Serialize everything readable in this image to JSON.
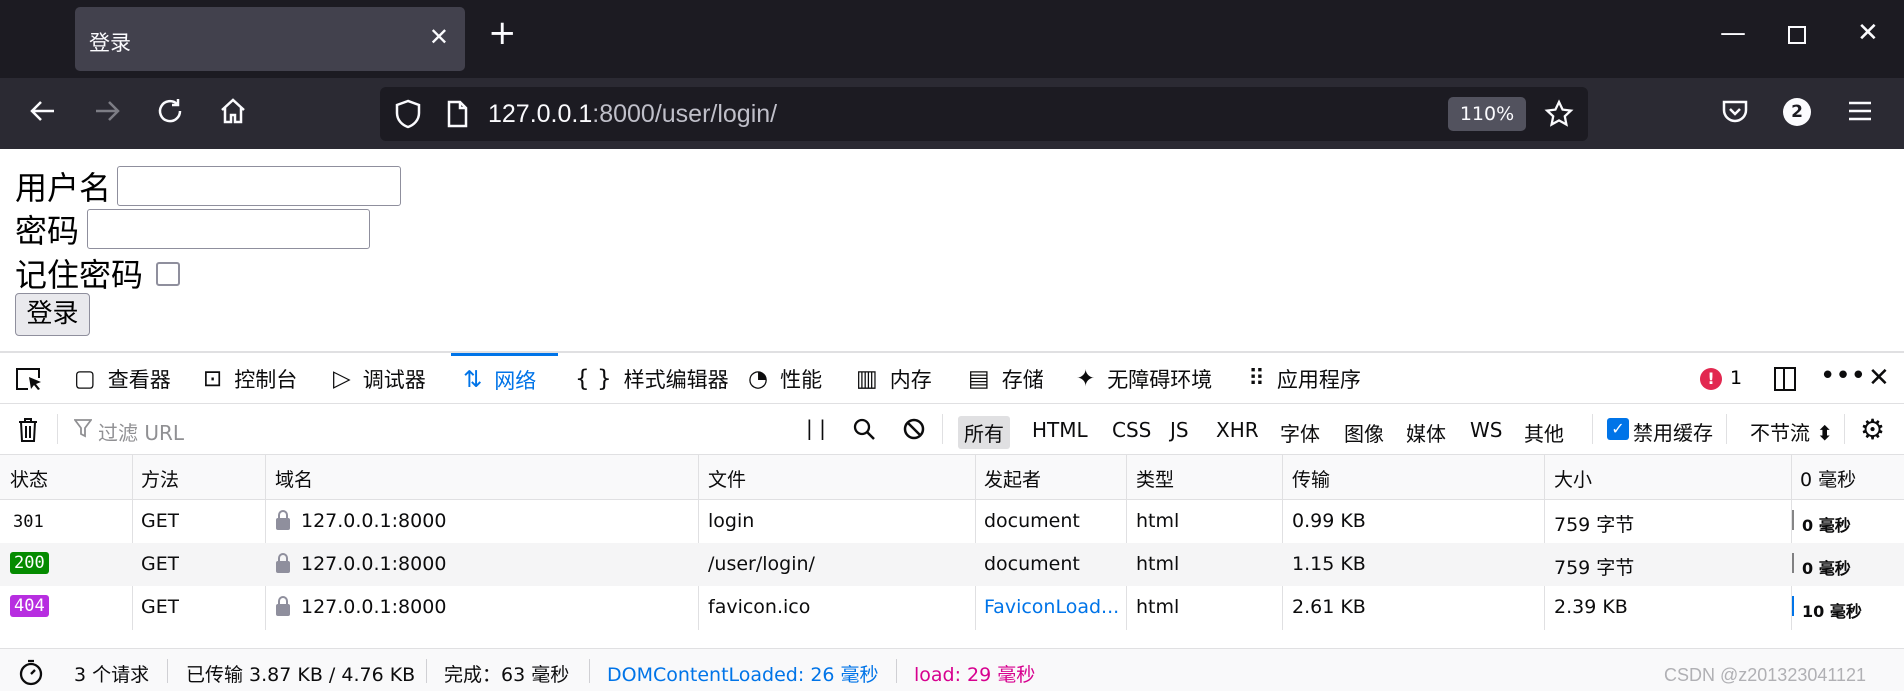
{
  "browser": {
    "tab_title": "登录",
    "url_host": "127.0.0.1",
    "url_rest": ":8000/user/login/",
    "zoom": "110%",
    "notification_count": "2"
  },
  "page": {
    "username_label": "用户名",
    "password_label": "密码",
    "remember_label": "记住密码",
    "login_button": "登录"
  },
  "devtools": {
    "tabs": [
      "查看器",
      "控制台",
      "调试器",
      "网络",
      "样式编辑器",
      "性能",
      "内存",
      "存储",
      "无障碍环境",
      "应用程序"
    ],
    "active_tab": "网络",
    "error_count": "1",
    "filter_placeholder": "过滤 URL",
    "type_filters": [
      "所有",
      "HTML",
      "CSS",
      "JS",
      "XHR",
      "字体",
      "图像",
      "媒体",
      "WS",
      "其他"
    ],
    "disable_cache_label": "禁用缓存",
    "throttle_label": "不节流",
    "columns": [
      "状态",
      "方法",
      "域名",
      "文件",
      "发起者",
      "类型",
      "传输",
      "大小",
      "0 毫秒"
    ],
    "requests": [
      {
        "status": "301",
        "method": "GET",
        "domain": "127.0.0.1:8000",
        "file": "login",
        "initiator": "document",
        "type": "html",
        "transferred": "0.99 KB",
        "size": "759 字节",
        "time": "0 毫秒"
      },
      {
        "status": "200",
        "method": "GET",
        "domain": "127.0.0.1:8000",
        "file": "/user/login/",
        "initiator": "document",
        "type": "html",
        "transferred": "1.15 KB",
        "size": "759 字节",
        "time": "0 毫秒"
      },
      {
        "status": "404",
        "method": "GET",
        "domain": "127.0.0.1:8000",
        "file": "favicon.ico",
        "initiator": "FaviconLoad...",
        "type": "html",
        "transferred": "2.61 KB",
        "size": "2.39 KB",
        "time": "10 毫秒"
      }
    ],
    "statusbar": {
      "requests": "3 个请求",
      "transferred": "已传输 3.87 KB / 4.76 KB",
      "finish": "完成：63 毫秒",
      "dom_content_loaded": "DOMContentLoaded: 26 毫秒",
      "load": "load: 29 毫秒"
    },
    "colors": {
      "accent": "#0074e8",
      "status_200": "#058b00",
      "status_404": "#b72ee0",
      "load_pink": "#d7008f"
    }
  },
  "watermark": "CSDN @z201323041121"
}
